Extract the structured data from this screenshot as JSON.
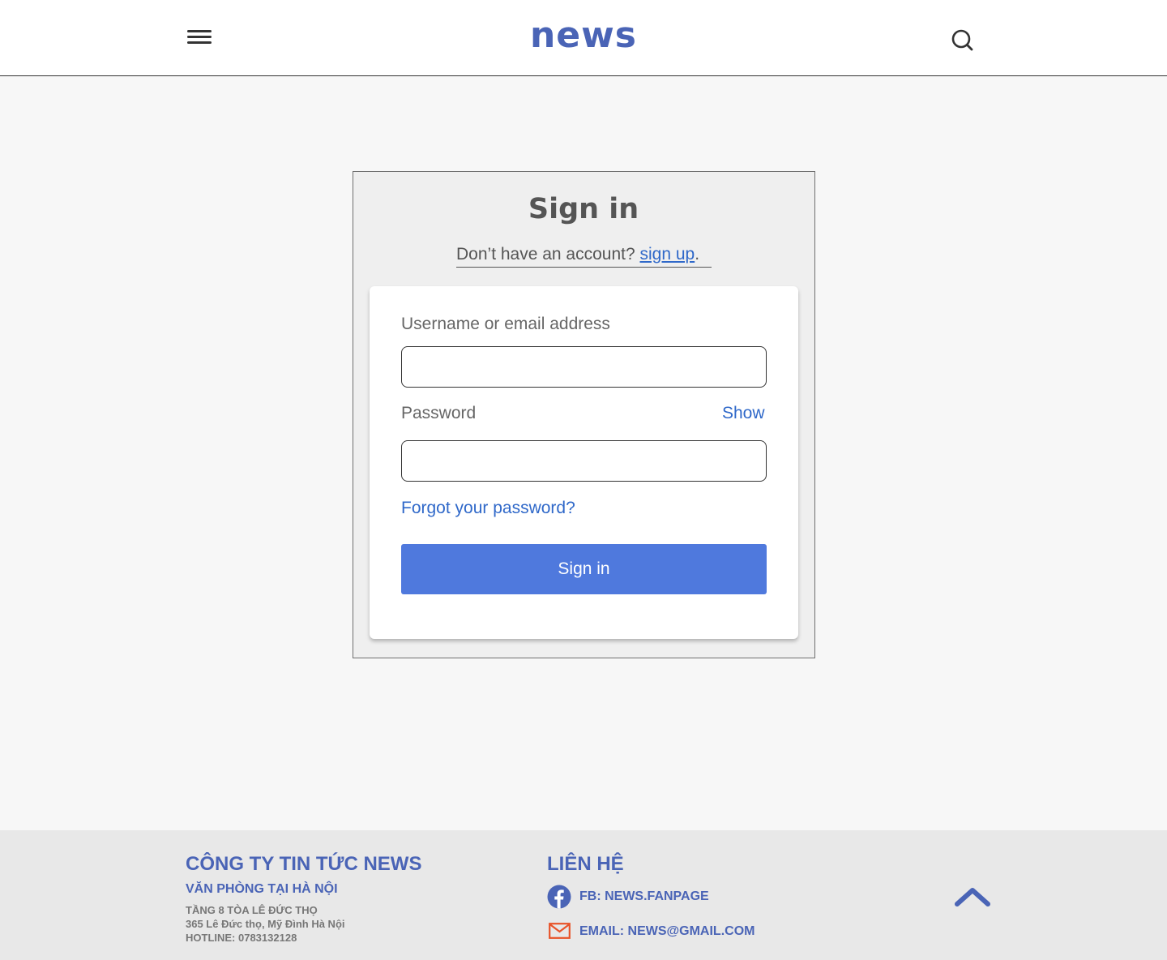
{
  "header": {
    "logo": "news",
    "menu_icon": "hamburger-menu-icon",
    "search_icon": "search-icon"
  },
  "signin": {
    "title": "Sign in",
    "no_account": "Don’t have an account?",
    "signup_link": "sign up",
    "signup_suffix": ".",
    "username_label": "Username or email address",
    "username_value": "",
    "password_label": "Password",
    "password_value": "",
    "show_label": "Show",
    "forgot_label": "Forgot your password?",
    "submit_label": "Sign in"
  },
  "footer": {
    "company": "CÔNG TY TIN TỨC NEWS",
    "office": "VĂN PHÒNG TẠI HÀ NỘI",
    "address_lines": [
      "TẦNG 8 TÒA LÊ ĐỨC THỌ",
      "365 Lê Đức thọ, Mỹ Đình Hà Nội",
      "HOTLINE: 0783132128"
    ],
    "contact_title": "LIÊN HỆ",
    "facebook": "FB: NEWS.FANPAGE",
    "email": "EMAIL: NEWS@GMAIL.COM",
    "facebook_icon": "facebook-icon",
    "email_icon": "mail-icon",
    "top_icon": "chevron-up-icon"
  },
  "colors": {
    "brand": "#4a64b6",
    "link": "#2f68c9",
    "button": "#4f79dd",
    "mail_icon": "#e8542a"
  }
}
